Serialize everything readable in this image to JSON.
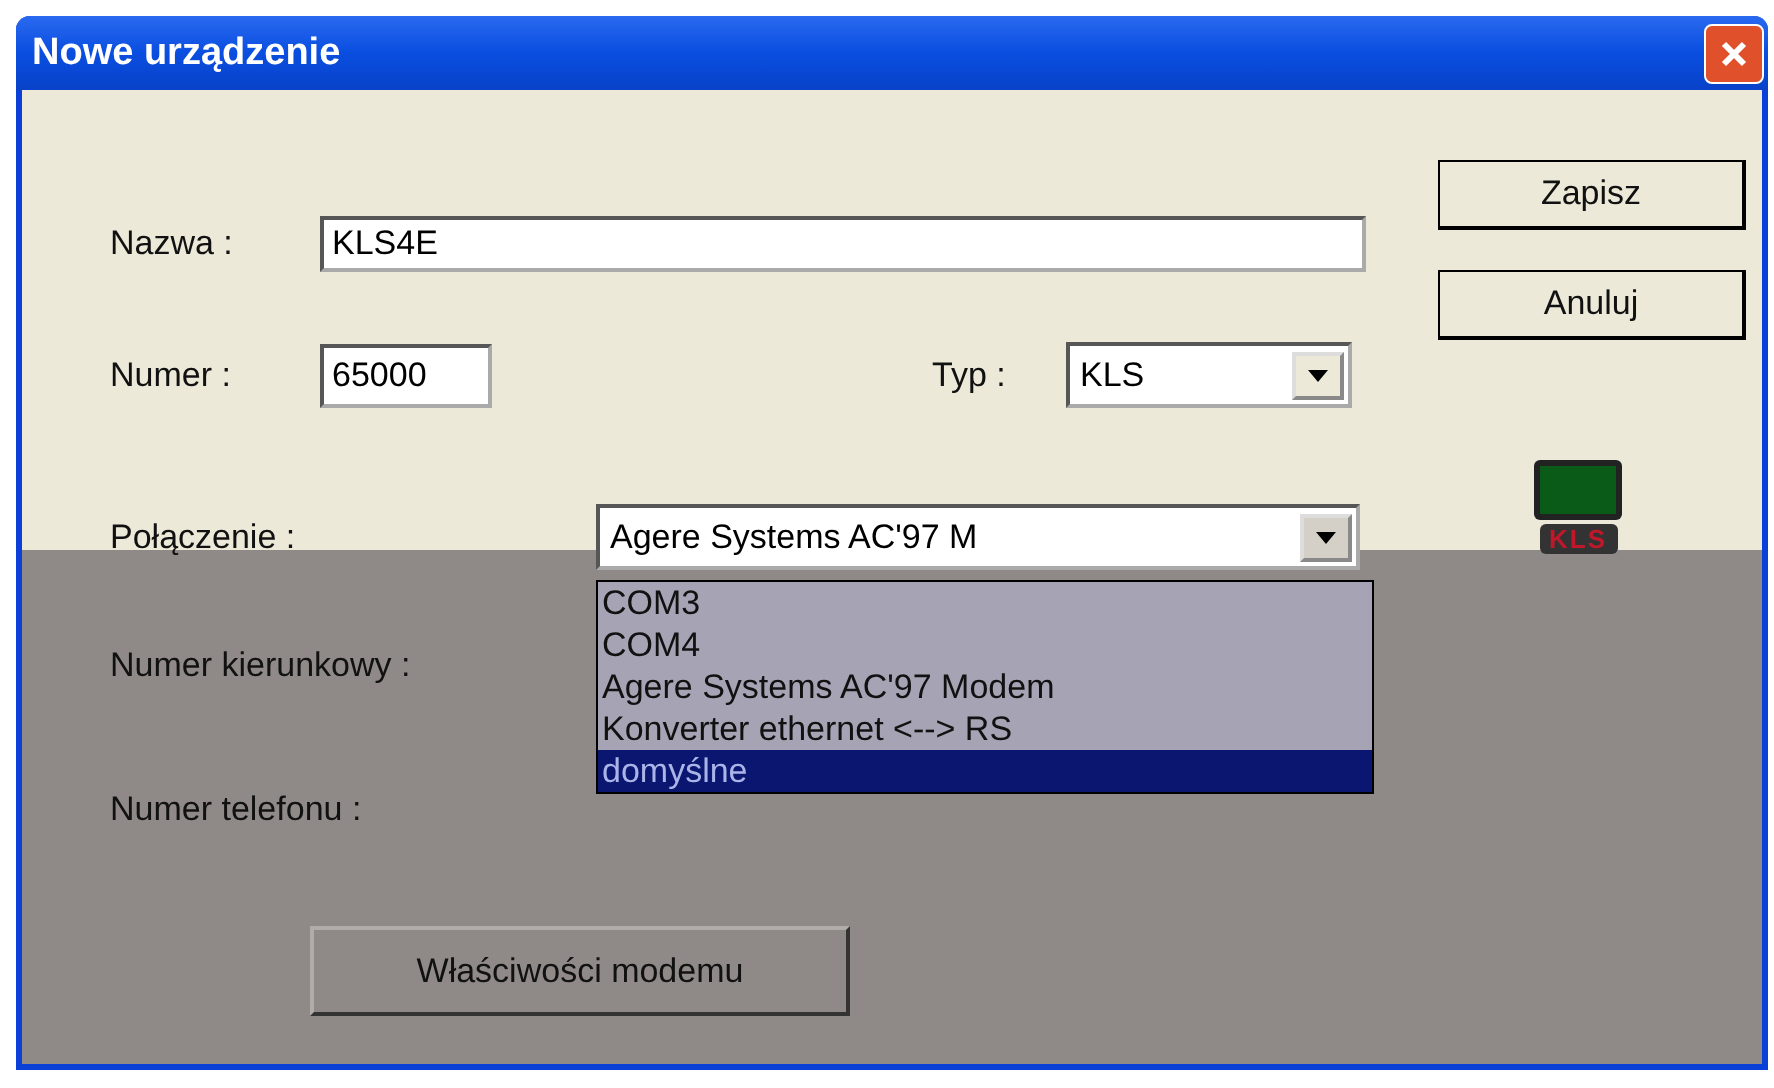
{
  "window": {
    "title": "Nowe urządzenie"
  },
  "name": {
    "label": "Nazwa :",
    "value": "KLS4E"
  },
  "number": {
    "label": "Numer :",
    "value": "65000"
  },
  "type": {
    "label": "Typ :",
    "value": "KLS"
  },
  "connection": {
    "label": "Połączenie :",
    "value": "Agere Systems AC'97 M",
    "expanded": true,
    "options": [
      {
        "label": "COM3",
        "selected": false
      },
      {
        "label": "COM4",
        "selected": false
      },
      {
        "label": "Agere Systems AC'97 Modem",
        "selected": false
      },
      {
        "label": "Konverter ethernet <--> RS",
        "selected": false
      },
      {
        "label": "domyślne",
        "selected": true
      }
    ]
  },
  "area_code": {
    "label": "Numer kierunkowy :"
  },
  "phone": {
    "label": "Numer telefonu :"
  },
  "device_logo": {
    "text": "KLS"
  },
  "buttons": {
    "save": "Zapisz",
    "cancel": "Anuluj",
    "modem": "Właściwości modemu"
  }
}
